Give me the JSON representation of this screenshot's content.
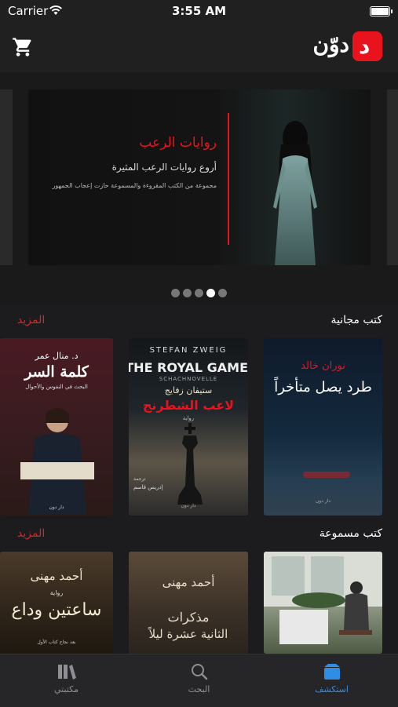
{
  "status_bar": {
    "carrier": "Carrier",
    "time": "3:55 AM",
    "battery_level": 1.0
  },
  "header": {
    "logo_text": "دوّن",
    "logo_badge": "د"
  },
  "banner": {
    "title": "روايات الرعب",
    "subtitle": "أروع روايات الرعب المثيرة",
    "description": "مجموعة من الكتب المقروءة والمسموعة حازت إعجاب الجمهور",
    "pages": 5,
    "active_page": 4
  },
  "sections": [
    {
      "heading": "كتب مجانية",
      "more": "المزيد",
      "books": [
        {
          "author": "نوران خالد",
          "title": "طرد يصل متأخراً",
          "publisher": "دار دون"
        },
        {
          "top": "STEFAN ZWEIG",
          "title_en": "THE ROYAL GAME",
          "subtitle_en": "SCHACHNOVELLE",
          "author": "ستيفان زفايج",
          "title": "لاعب الشطرنج",
          "genre": "رواية",
          "translator_label": "ترجمة",
          "translator": "إدريس قاسم",
          "publisher": "دار دون"
        },
        {
          "author": "د. منال عمر",
          "title": "كلمة السر",
          "subtitle": "البحث في النفوس والأحوال",
          "publisher": "دار دون"
        }
      ]
    },
    {
      "heading": "كتب مسموعة",
      "more": "المزيد",
      "books": [
        {
          "author": "",
          "title": ""
        },
        {
          "author": "أحمد مهنى",
          "title": "مذكرات",
          "title2": "الثانية عشرة ليلاً"
        },
        {
          "author": "أحمد مهنى",
          "genre": "رواية",
          "title": "ساعتين وداع",
          "note": "بعد نجاح كتاب الأول"
        }
      ]
    }
  ],
  "tabs": [
    {
      "label": "استكشف",
      "icon": "explore-icon",
      "active": true
    },
    {
      "label": "البحث",
      "icon": "search-icon",
      "active": false
    },
    {
      "label": "مكتبتي",
      "icon": "library-icon",
      "active": false
    }
  ],
  "colors": {
    "brand_red": "#e8131c",
    "tab_active": "#2f8de4",
    "background": "#1c1c1e"
  }
}
